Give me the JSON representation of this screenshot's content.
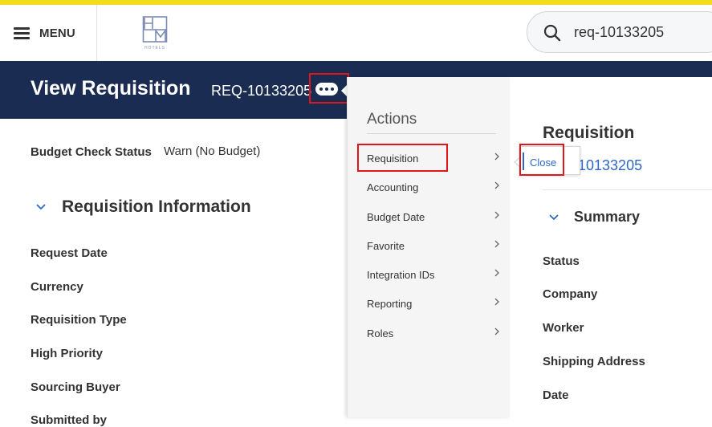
{
  "topbar": {
    "menu_label": "MENU",
    "logo_text": "HOTELS",
    "search_value": "req-10133205"
  },
  "header": {
    "title": "View Requisition",
    "req_id": "REQ-10133205"
  },
  "left": {
    "budget_check_label": "Budget Check Status",
    "budget_check_value": "Warn (No Budget)",
    "section_title": "Requisition Information",
    "fields": [
      "Request Date",
      "Currency",
      "Requisition Type",
      "High Priority",
      "Sourcing Buyer",
      "Submitted by"
    ]
  },
  "actions": {
    "title": "Actions",
    "items": [
      "Requisition",
      "Accounting",
      "Budget Date",
      "Favorite",
      "Integration IDs",
      "Reporting",
      "Roles"
    ]
  },
  "popup": {
    "close_label": "Close"
  },
  "right": {
    "title": "Requisition",
    "req_link": "10133205",
    "summary_title": "Summary",
    "fields": [
      "Status",
      "Company",
      "Worker",
      "Shipping Address",
      "Date"
    ]
  },
  "colors": {
    "header_band": "#1b2c52",
    "top_strip": "#f2dc1b",
    "highlight": "#e0161c",
    "link": "#2d67c4"
  }
}
